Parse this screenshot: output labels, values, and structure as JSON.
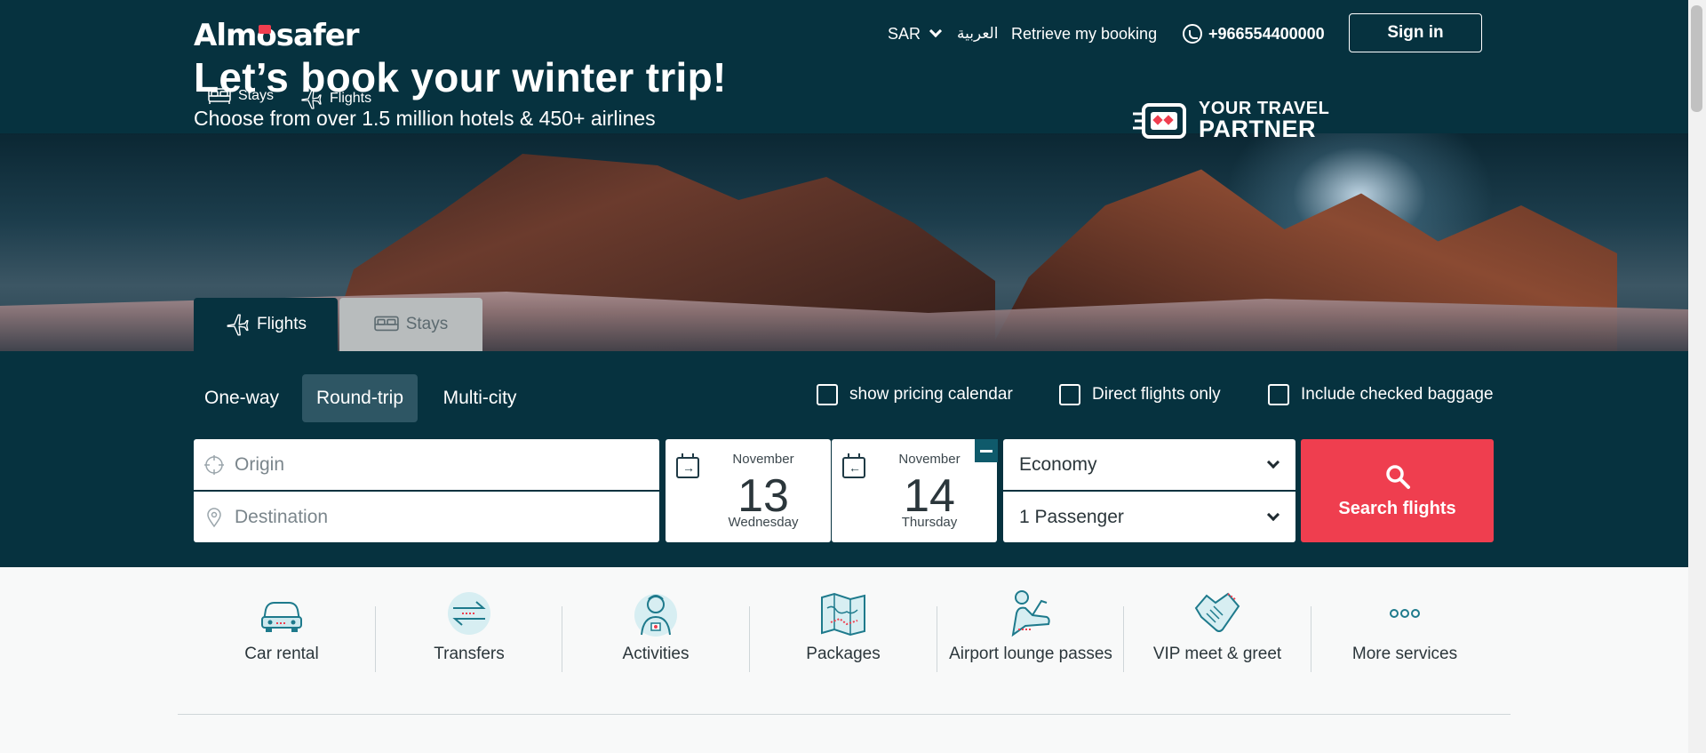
{
  "header": {
    "logo": "Almosafer",
    "currency": "SAR",
    "language": "العربية",
    "retrieve_booking": "Retrieve my booking",
    "phone": "+966554400000",
    "sign_in": "Sign in",
    "subnav": {
      "stays": "Stays",
      "flights": "Flights"
    }
  },
  "hero": {
    "title": "Let’s book your winter trip!",
    "subtitle": "Choose from over 1.5 million hotels & 450+ airlines",
    "partner_line1": "YOUR TRAVEL",
    "partner_line2": "PARTNER"
  },
  "tabs": [
    {
      "label": "Flights",
      "active": true
    },
    {
      "label": "Stays",
      "active": false
    }
  ],
  "trip_types": [
    "One-way",
    "Round-trip",
    "Multi-city"
  ],
  "options": {
    "pricing_calendar": "show pricing calendar",
    "direct_only": "Direct flights only",
    "checked_baggage": "Include checked baggage"
  },
  "search": {
    "origin_placeholder": "Origin",
    "destination_placeholder": "Destination",
    "depart": {
      "month": "November",
      "day": "13",
      "weekday": "Wednesday"
    },
    "return": {
      "month": "November",
      "day": "14",
      "weekday": "Thursday"
    },
    "cabin": "Economy",
    "passengers": "1 Passenger",
    "button": "Search flights"
  },
  "services": [
    {
      "label": "Car rental",
      "icon": "car-icon"
    },
    {
      "label": "Transfers",
      "icon": "transfer-arrows-icon"
    },
    {
      "label": "Activities",
      "icon": "person-activity-icon"
    },
    {
      "label": "Packages",
      "icon": "map-icon"
    },
    {
      "label": "Airport lounge passes",
      "icon": "lounge-chair-icon"
    },
    {
      "label": "VIP meet & greet",
      "icon": "handshake-icon"
    },
    {
      "label": "More services",
      "icon": "more-dots-icon"
    }
  ],
  "colors": {
    "header_bg": "#06323f",
    "accent": "#ef3e4f",
    "active_trip": "#2e5664"
  }
}
